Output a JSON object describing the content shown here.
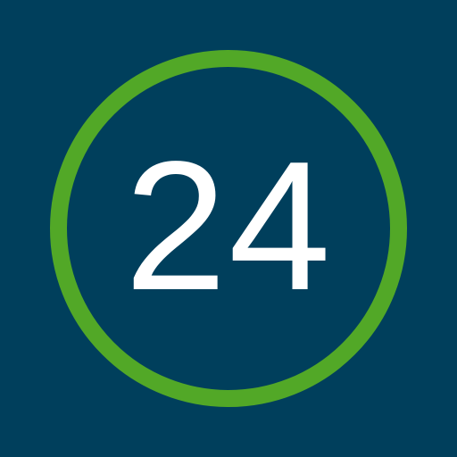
{
  "badge": {
    "value": "24"
  },
  "colors": {
    "background": "#003f5c",
    "ring": "#52a827",
    "text": "#ffffff"
  }
}
